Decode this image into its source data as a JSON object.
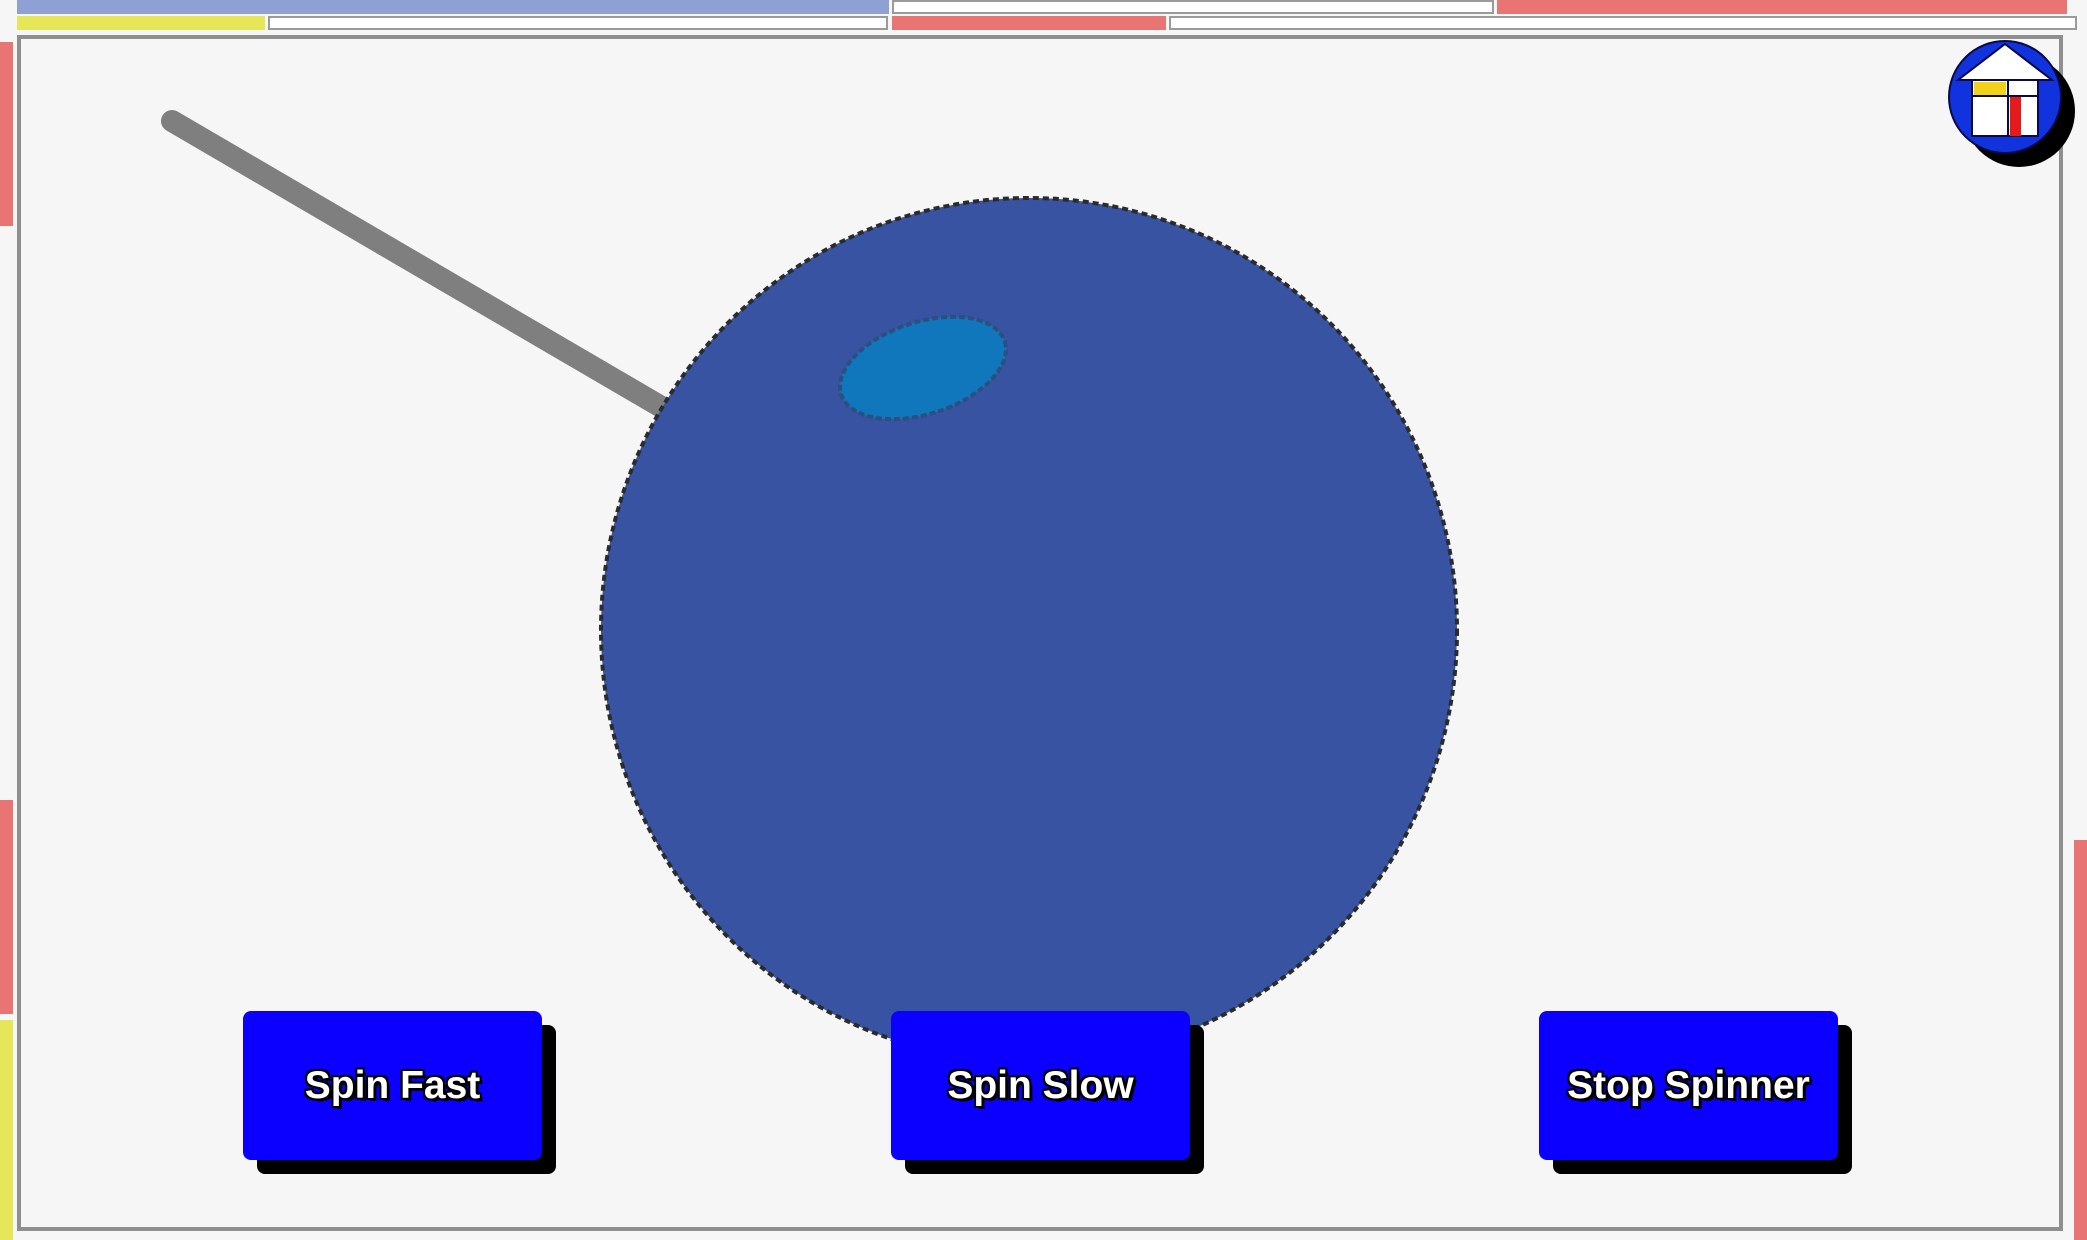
{
  "controls": {
    "spin_fast_label": "Spin Fast",
    "spin_slow_label": "Spin Slow",
    "stop_label": "Stop Spinner"
  },
  "icons": {
    "home": "home-icon"
  },
  "colors": {
    "background": "#f6f6f6",
    "spinner_disc": "#3953a3",
    "spinner_marker": "#1077bd",
    "pointer": "#7f7f7f",
    "button_fill": "#0b00ff",
    "button_shadow": "#000000",
    "accent_blue": "#8fa0d4",
    "accent_red": "#e87474",
    "accent_yellow": "#e6e65a"
  }
}
